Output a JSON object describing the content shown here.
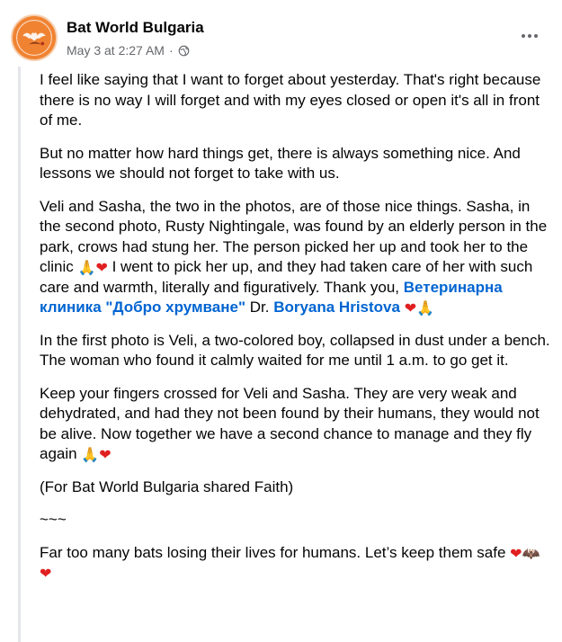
{
  "page": {
    "name": "Bat World Bulgaria",
    "date": "May 3 at 2:27 AM",
    "separator": "·"
  },
  "icons": {
    "avatar": "bat-world-logo",
    "privacy": "globe-icon",
    "menu": "more-options-icon",
    "heart": "❤",
    "praying_hands": "🙏",
    "bat": "🦇"
  },
  "colors": {
    "link": "#0064d1",
    "meta": "#65676b",
    "avatar_bg": "#f08332"
  },
  "post": {
    "p1": "I feel like saying that I want to forget about yesterday. That's right because there is no way I will forget and with my eyes closed or open it's all in front of me.",
    "p2": "But no matter how hard things get, there is always something nice. And lessons we should not forget to take with us.",
    "p3_a": "Veli and Sasha, the two in the photos, are of those nice things. Sasha, in the second photo, Rusty Nightingale, was found by an elderly person in the park, crows had stung her. The person picked her up and took her to the clinic ",
    "p3_b": " I went to pick her up, and they had taken care of her with such care and warmth, literally and figuratively. Thank you, ",
    "p3_link1": "Ветеринарна клиника \"Добро хрумване\"",
    "p3_c": " Dr. ",
    "p3_link2": "Boryana Hristova",
    "p4": "In the first photo is Veli, a two-colored boy, collapsed in dust under a bench. The woman who found it calmly waited for me until 1 a.m. to go get it.",
    "p5": "Keep your fingers crossed for Veli and Sasha. They are very weak and dehydrated, and had they not been found by their humans, they would not be alive. Now together we have a second chance to manage and they fly again ",
    "p6": "(For Bat World Bulgaria shared Faith)",
    "p7": "~~~",
    "p8": "Far too many bats losing their lives for humans. Let’s keep them safe "
  }
}
